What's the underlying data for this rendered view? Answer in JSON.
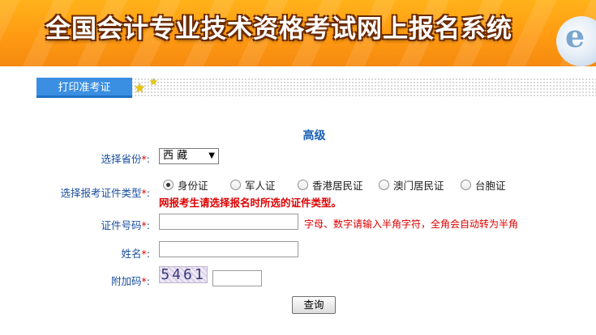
{
  "banner": {
    "title": "全国会计专业技术资格考试网上报名系统"
  },
  "tabs": [
    {
      "label": "打印准考证"
    }
  ],
  "form": {
    "heading": "高级",
    "required_mark": "*",
    "province": {
      "label": "选择省份",
      "value": "西 藏"
    },
    "id_type": {
      "label": "选择报考证件类型",
      "options": [
        "身份证",
        "军人证",
        "香港居民证",
        "澳门居民证",
        "台胞证"
      ],
      "selected": "身份证",
      "warning": "网报考生请选择报名时所选的证件类型。"
    },
    "id_number": {
      "label": "证件号码",
      "value": "",
      "hint": "字母、数字请输入半角字符，全角会自动转为半角"
    },
    "name": {
      "label": "姓名",
      "value": ""
    },
    "captcha": {
      "label": "附加码",
      "image_text": "5461",
      "value": ""
    },
    "submit_label": "查询"
  },
  "colors": {
    "banner": "#ff9a12",
    "tab": "#3a8fe3",
    "label": "#1a4f9c",
    "warning": "#dd0000"
  }
}
